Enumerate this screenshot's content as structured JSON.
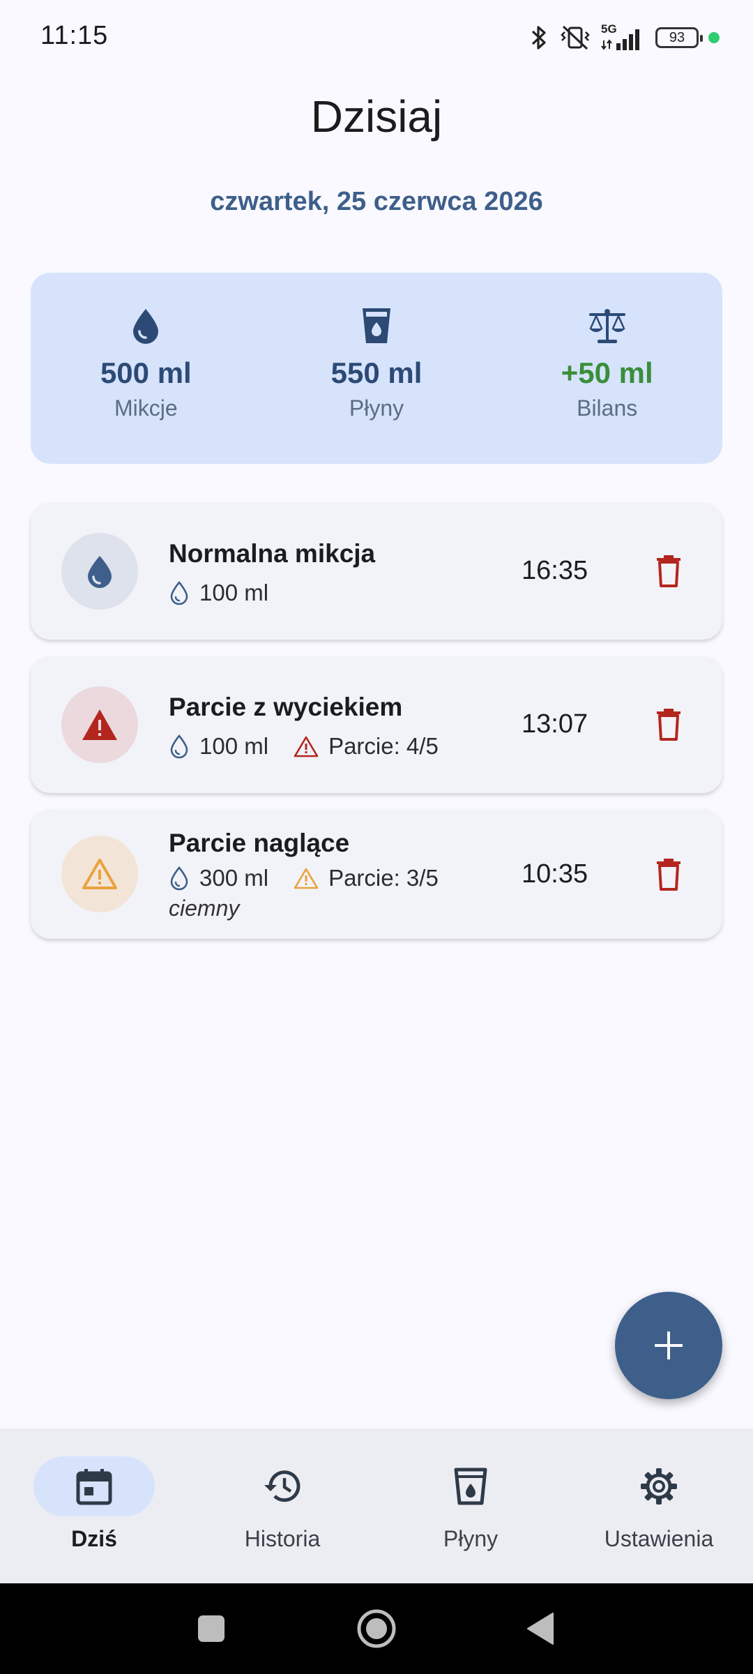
{
  "status_bar": {
    "time": "11:15",
    "battery": "93",
    "network": "5G",
    "icons": [
      "bluetooth-icon",
      "vibrate-off-icon",
      "signal-icon",
      "battery-icon",
      "camera-active-dot"
    ]
  },
  "header": {
    "title": "Dzisiaj",
    "date": "czwartek, 25 czerwca 2026"
  },
  "summary": {
    "items": [
      {
        "icon": "drop-icon",
        "value": "500 ml",
        "label": "Mikcje"
      },
      {
        "icon": "cup-icon",
        "value": "550 ml",
        "label": "Płyny"
      },
      {
        "icon": "scale-icon",
        "value": "+50 ml",
        "label": "Bilans"
      }
    ]
  },
  "entries": [
    {
      "icon": "drop-icon",
      "title": "Normalna mikcja",
      "volume": "100 ml",
      "urge": null,
      "note": null,
      "time": "16:35"
    },
    {
      "icon": "warning-filled-icon",
      "title": "Parcie z wyciekiem",
      "volume": "100 ml",
      "urge": "Parcie: 4/5",
      "note": null,
      "time": "13:07"
    },
    {
      "icon": "warning-outline-icon",
      "title": "Parcie naglące",
      "volume": "300 ml",
      "urge": "Parcie: 3/5",
      "note": "ciemny",
      "time": "10:35"
    }
  ],
  "fab": {
    "icon": "plus-icon"
  },
  "bottom_nav": {
    "items": [
      {
        "icon": "calendar-icon",
        "label": "Dziś",
        "active": true
      },
      {
        "icon": "history-icon",
        "label": "Historia",
        "active": false
      },
      {
        "icon": "cup-icon",
        "label": "Płyny",
        "active": false
      },
      {
        "icon": "gear-icon",
        "label": "Ustawienia",
        "active": false
      }
    ]
  },
  "colors": {
    "primary": "#3e5f8a",
    "summary_bg": "#d6e3fb",
    "positive": "#3a8e3a",
    "danger": "#b3261e",
    "warning": "#e8a33c"
  }
}
